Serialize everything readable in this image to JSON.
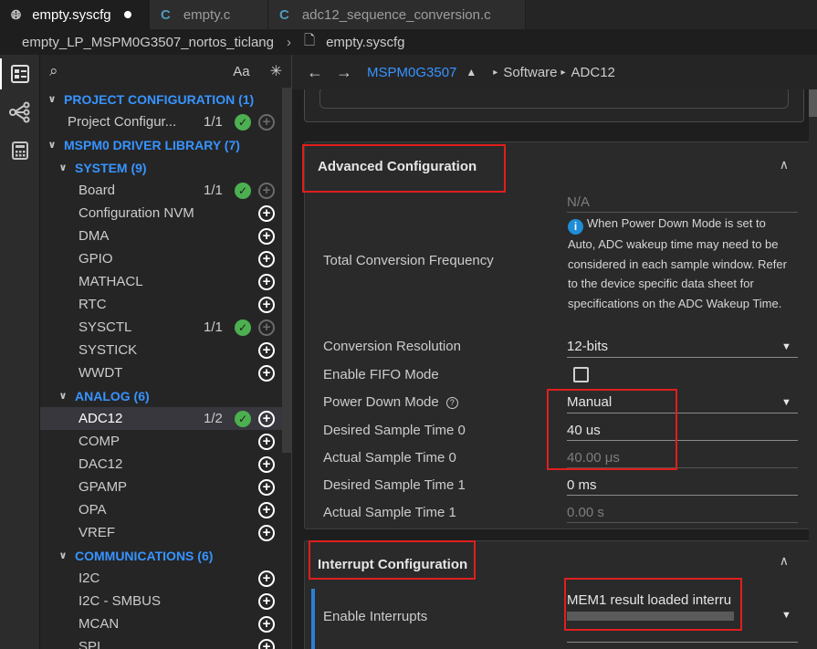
{
  "tabs": [
    {
      "label": "empty.syscfg",
      "icon": "globe-icon",
      "active": true,
      "modified": true
    },
    {
      "label": "empty.c",
      "icon": "c-file-icon",
      "active": false
    },
    {
      "label": "adc12_sequence_conversion.c",
      "icon": "c-file-icon",
      "active": false
    }
  ],
  "breadcrumb": {
    "project": "empty_LP_MSPM0G3507_nortos_ticlang",
    "file": "empty.syscfg"
  },
  "activity_icons": [
    "config-view-icon",
    "device-tree-icon",
    "calculator-icon"
  ],
  "sidebar": {
    "search_icon": "search-icon",
    "match_case": "Aa",
    "filter_icon": "asterisk-icon",
    "tree": [
      {
        "type": "cat",
        "level": 0,
        "label": "PROJECT CONFIGURATION (1)"
      },
      {
        "type": "item",
        "level": 1,
        "label": "Project Configur...",
        "count": "1/1",
        "check": true,
        "add": "dim"
      },
      {
        "type": "cat",
        "level": 0,
        "label": "MSPM0 DRIVER LIBRARY (7)"
      },
      {
        "type": "cat",
        "level": 1,
        "label": "SYSTEM (9)"
      },
      {
        "type": "item",
        "level": 2,
        "label": "Board",
        "count": "1/1",
        "check": true,
        "add": "dim"
      },
      {
        "type": "item",
        "level": 2,
        "label": "Configuration NVM",
        "add": "on"
      },
      {
        "type": "item",
        "level": 2,
        "label": "DMA",
        "add": "on"
      },
      {
        "type": "item",
        "level": 2,
        "label": "GPIO",
        "add": "on"
      },
      {
        "type": "item",
        "level": 2,
        "label": "MATHACL",
        "add": "on"
      },
      {
        "type": "item",
        "level": 2,
        "label": "RTC",
        "add": "on"
      },
      {
        "type": "item",
        "level": 2,
        "label": "SYSCTL",
        "count": "1/1",
        "check": true,
        "add": "dim"
      },
      {
        "type": "item",
        "level": 2,
        "label": "SYSTICK",
        "add": "on"
      },
      {
        "type": "item",
        "level": 2,
        "label": "WWDT",
        "add": "on"
      },
      {
        "type": "cat",
        "level": 1,
        "label": "ANALOG (6)"
      },
      {
        "type": "item",
        "level": 2,
        "label": "ADC12",
        "count": "1/2",
        "check": true,
        "add": "on",
        "selected": true
      },
      {
        "type": "item",
        "level": 2,
        "label": "COMP",
        "add": "on"
      },
      {
        "type": "item",
        "level": 2,
        "label": "DAC12",
        "add": "on"
      },
      {
        "type": "item",
        "level": 2,
        "label": "GPAMP",
        "add": "on"
      },
      {
        "type": "item",
        "level": 2,
        "label": "OPA",
        "add": "on"
      },
      {
        "type": "item",
        "level": 2,
        "label": "VREF",
        "add": "on"
      },
      {
        "type": "cat",
        "level": 1,
        "label": "COMMUNICATIONS (6)"
      },
      {
        "type": "item",
        "level": 2,
        "label": "I2C",
        "add": "on"
      },
      {
        "type": "item",
        "level": 2,
        "label": "I2C - SMBUS",
        "add": "on"
      },
      {
        "type": "item",
        "level": 2,
        "label": "MCAN",
        "add": "on"
      },
      {
        "type": "item",
        "level": 2,
        "label": "SPI",
        "add": "on"
      }
    ]
  },
  "header": {
    "device": "MSPM0G3507",
    "path": [
      "Software",
      "ADC12"
    ]
  },
  "advanced": {
    "title": "Advanced Configuration",
    "total_freq_label": "Total Conversion Frequency",
    "total_freq_value": "N/A",
    "note": "When Power Down Mode is set to Auto, ADC wakeup time may need to be considered in each sample window. Refer to the device specific data sheet for specifications on the ADC Wakeup Time.",
    "resolution_label": "Conversion Resolution",
    "resolution_value": "12-bits",
    "fifo_label": "Enable FIFO Mode",
    "fifo_checked": false,
    "power_label": "Power Down Mode",
    "power_value": "Manual",
    "desired0_label": "Desired Sample Time 0",
    "desired0_value": "40 us",
    "actual0_label": "Actual Sample Time 0",
    "actual0_value": "40.00 μs",
    "desired1_label": "Desired Sample Time 1",
    "desired1_value": "0 ms",
    "actual1_label": "Actual Sample Time 1",
    "actual1_value": "0.00 s"
  },
  "interrupt": {
    "title": "Interrupt Configuration",
    "enable_label": "Enable Interrupts",
    "enable_value": "MEM1 result loaded interru"
  },
  "colors": {
    "accent_blue": "#3794ff",
    "check_green": "#4caf50",
    "highlight_red": "#e01e1e",
    "info_blue": "#1f8dd6"
  }
}
